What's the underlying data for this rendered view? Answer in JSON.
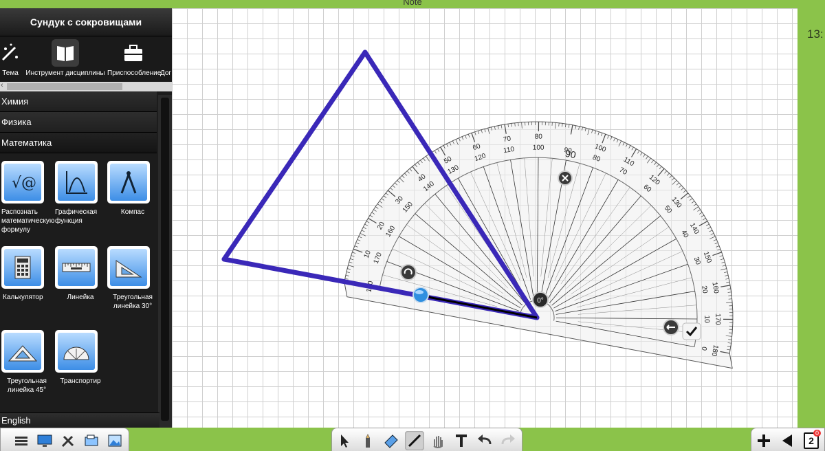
{
  "window": {
    "title": "Note",
    "clock": "13:"
  },
  "sidebar": {
    "title": "Сундук с сокровищами",
    "tabs": [
      {
        "label": "Тема",
        "icon": "magic-wand-icon"
      },
      {
        "label": "Инструмент дисциплины",
        "icon": "book-icon"
      },
      {
        "label": "Приспособление",
        "icon": "toolbox-icon"
      },
      {
        "label": "Дог",
        "icon": ""
      }
    ],
    "categories": [
      {
        "label": "Химия"
      },
      {
        "label": "Физика"
      },
      {
        "label": "Математика"
      }
    ],
    "tools": [
      {
        "label": "Распознать математическую формулу",
        "icon": "formula-icon"
      },
      {
        "label": "Графическая функция",
        "icon": "graph-icon"
      },
      {
        "label": "Компас",
        "icon": "compass-icon"
      },
      {
        "label": "Калькулятор",
        "icon": "calculator-icon"
      },
      {
        "label": "Линейка",
        "icon": "ruler-icon"
      },
      {
        "label": "Треугольная линейка 30°",
        "icon": "set-square-30-icon"
      },
      {
        "label": "Треугольная линейка 45°",
        "icon": "set-square-45-icon"
      },
      {
        "label": "Транспортир",
        "icon": "protractor-icon"
      }
    ],
    "language": "English"
  },
  "protractor": {
    "outer_labels": [
      "0",
      "10",
      "20",
      "30",
      "40",
      "50",
      "60",
      "70",
      "80",
      "90",
      "100",
      "110",
      "120",
      "130",
      "140",
      "150",
      "160",
      "170",
      "180"
    ],
    "inner_labels": [
      "180",
      "170",
      "160",
      "150",
      "140",
      "130",
      "120",
      "110",
      "100",
      "90",
      "80",
      "70",
      "60",
      "50",
      "40",
      "30",
      "20",
      "10",
      "0"
    ],
    "angle_readout": "0°"
  },
  "page": {
    "number": "2",
    "badge": "0"
  },
  "colors": {
    "shape_stroke": "#3a28b8",
    "accent_green": "#8bc34a",
    "sidebar_bg": "#1c1c1c"
  },
  "toolbar": {
    "left": [
      "menu-icon",
      "screen-icon",
      "tools-icon",
      "monitor-icon",
      "image-icon"
    ],
    "center": [
      "pointer-icon",
      "pen-icon",
      "eraser-icon",
      "line-icon",
      "hand-icon",
      "text-icon",
      "undo-icon",
      "redo-icon"
    ],
    "right": [
      "add-page-icon",
      "prev-page-icon",
      "page-counter"
    ]
  }
}
